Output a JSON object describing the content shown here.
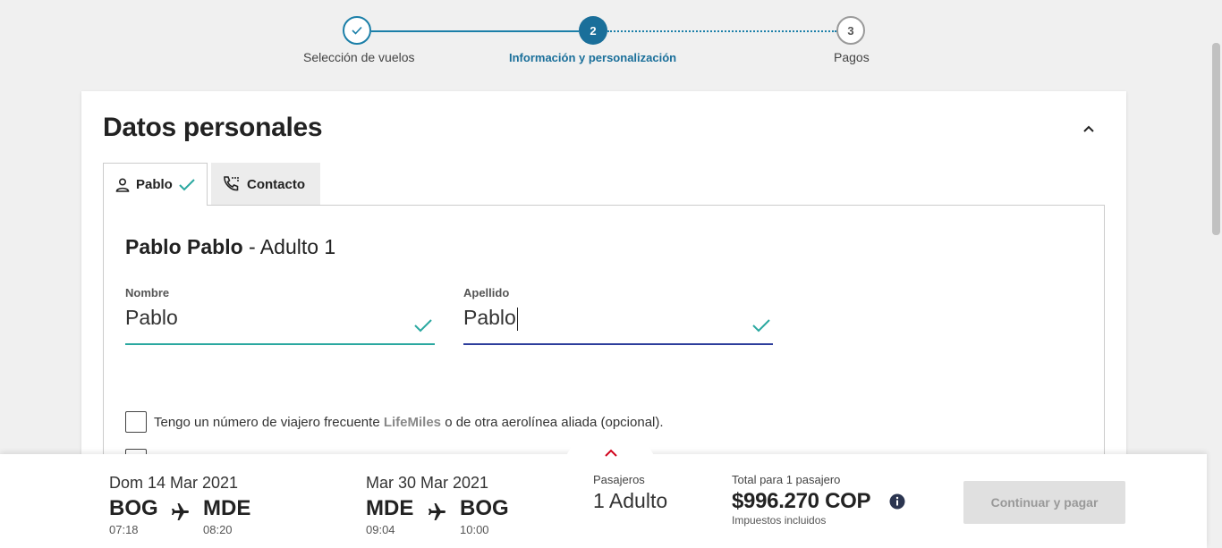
{
  "stepper": {
    "steps": [
      {
        "label": "Selección de vuelos",
        "number": "",
        "status": "completed"
      },
      {
        "label": "Información y personalización",
        "number": "2",
        "status": "active"
      },
      {
        "label": "Pagos",
        "number": "3",
        "status": "pending"
      }
    ]
  },
  "section": {
    "title": "Datos personales"
  },
  "tabs": [
    {
      "label": "Pablo",
      "icon": "person-icon",
      "complete": true
    },
    {
      "label": "Contacto",
      "icon": "phone-icon"
    }
  ],
  "passenger": {
    "name": "Pablo Pablo",
    "type": " - Adulto 1"
  },
  "form": {
    "first_name": {
      "label": "Nombre",
      "value": "Pablo"
    },
    "last_name": {
      "label": "Apellido",
      "value": "Pablo"
    }
  },
  "frequent_flyer": {
    "text_before": "Tengo un número de viajero frecuente ",
    "brand": "LifeMiles",
    "text_after": " o de otra aerolínea aliada (opcional)."
  },
  "footer": {
    "outbound": {
      "date": "Dom 14 Mar 2021",
      "origin": "BOG",
      "origin_time": "07:18",
      "destination": "MDE",
      "destination_time": "08:20"
    },
    "return": {
      "date": "Mar 30 Mar 2021",
      "origin": "MDE",
      "origin_time": "09:04",
      "destination": "BOG",
      "destination_time": "10:00"
    },
    "passengers_label": "Pasajeros",
    "passengers_value": "1 Adulto",
    "total_label": "Total para 1 pasajero",
    "total_price": "$996.270 COP",
    "total_note": "Impuestos incluidos",
    "continue_label": "Continuar y pagar"
  },
  "colors": {
    "accent": "#1a6f9a",
    "valid": "#2aa8a0",
    "focus": "#2d3e9c",
    "alert": "#d0021b"
  }
}
